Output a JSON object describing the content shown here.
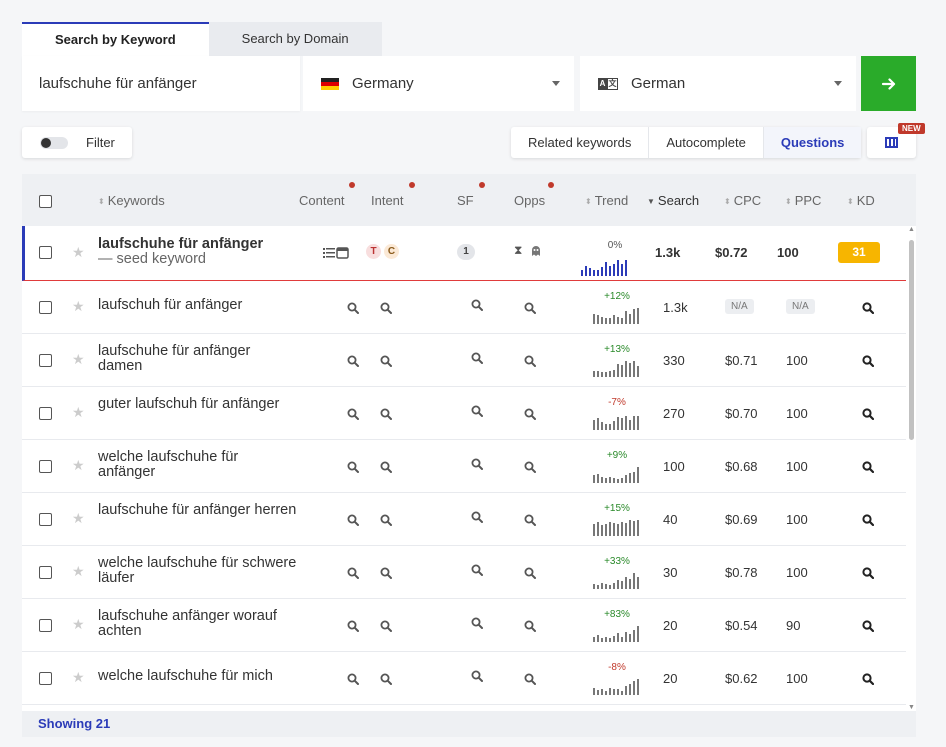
{
  "tabs": [
    {
      "label": "Search by Keyword",
      "active": true
    },
    {
      "label": "Search by Domain",
      "active": false
    }
  ],
  "search": {
    "keyword": "laufschuhe für anfänger",
    "country": "Germany",
    "language": "German",
    "go_icon": "arrow-right-icon"
  },
  "filter": {
    "label": "Filter"
  },
  "segments": [
    {
      "label": "Related keywords",
      "active": false
    },
    {
      "label": "Autocomplete",
      "active": false
    },
    {
      "label": "Questions",
      "active": true
    }
  ],
  "new_badge": "NEW",
  "table": {
    "headers": {
      "keywords": "Keywords",
      "content": "Content",
      "intent": "Intent",
      "sf": "SF",
      "opps": "Opps",
      "trend": "Trend",
      "search": "Search",
      "cpc": "CPC",
      "ppc": "PPC",
      "kd": "KD"
    },
    "seed": {
      "keyword": "laufschuhe für anfänger",
      "seed_label": "— seed keyword",
      "intent": [
        "T",
        "C"
      ],
      "sf": "1",
      "trend_pct": "0%",
      "search": "1.3k",
      "cpc": "$0.72",
      "ppc": "100",
      "kd": "31",
      "spark": [
        6,
        10,
        8,
        6,
        6,
        9,
        14,
        10,
        12,
        16,
        12,
        16
      ]
    },
    "rows": [
      {
        "keyword": "laufschuh für anfänger",
        "trend": "+12%",
        "dir": "up",
        "search": "1.3k",
        "cpc": "N/A",
        "ppc": "N/A",
        "spark": [
          10,
          9,
          7,
          6,
          6,
          9,
          7,
          6,
          13,
          10,
          15,
          16
        ]
      },
      {
        "keyword": "laufschuhe für anfänger damen",
        "trend": "+13%",
        "dir": "up",
        "search": "330",
        "cpc": "$0.71",
        "ppc": "100",
        "spark": [
          6,
          6,
          5,
          5,
          6,
          7,
          13,
          12,
          16,
          14,
          16,
          11
        ]
      },
      {
        "keyword": "guter laufschuh für anfänger",
        "trend": "-7%",
        "dir": "down",
        "search": "270",
        "cpc": "$0.70",
        "ppc": "100",
        "spark": [
          10,
          12,
          8,
          6,
          6,
          9,
          13,
          12,
          14,
          10,
          14,
          14
        ]
      },
      {
        "keyword": "welche laufschuhe für anfänger",
        "trend": "+9%",
        "dir": "up",
        "search": "100",
        "cpc": "$0.68",
        "ppc": "100",
        "spark": [
          8,
          9,
          6,
          5,
          6,
          5,
          4,
          5,
          8,
          10,
          11,
          16
        ]
      },
      {
        "keyword": "laufschuhe für anfänger herren",
        "trend": "+15%",
        "dir": "up",
        "search": "40",
        "cpc": "$0.69",
        "ppc": "100",
        "spark": [
          12,
          14,
          11,
          12,
          14,
          13,
          12,
          14,
          13,
          16,
          15,
          16
        ]
      },
      {
        "keyword": "welche laufschuhe für schwere läufer",
        "trend": "+33%",
        "dir": "up",
        "search": "30",
        "cpc": "$0.78",
        "ppc": "100",
        "spark": [
          5,
          4,
          6,
          5,
          4,
          6,
          9,
          8,
          12,
          10,
          16,
          12
        ]
      },
      {
        "keyword": "laufschuhe anfänger worauf achten",
        "trend": "+83%",
        "dir": "up",
        "search": "20",
        "cpc": "$0.54",
        "ppc": "90",
        "spark": [
          5,
          7,
          4,
          5,
          4,
          6,
          9,
          5,
          10,
          8,
          12,
          16
        ]
      },
      {
        "keyword": "welche laufschuhe für mich",
        "trend": "-8%",
        "dir": "down",
        "search": "20",
        "cpc": "$0.62",
        "ppc": "100",
        "spark": [
          7,
          5,
          6,
          4,
          7,
          6,
          6,
          4,
          9,
          11,
          14,
          16
        ]
      }
    ]
  },
  "footer": {
    "showing": "Showing 21"
  },
  "colors": {
    "accent": "#2b3bb8",
    "go": "#2aab2a",
    "kd": "#f7b500",
    "up": "#2a8a2a",
    "down": "#c0392b"
  }
}
